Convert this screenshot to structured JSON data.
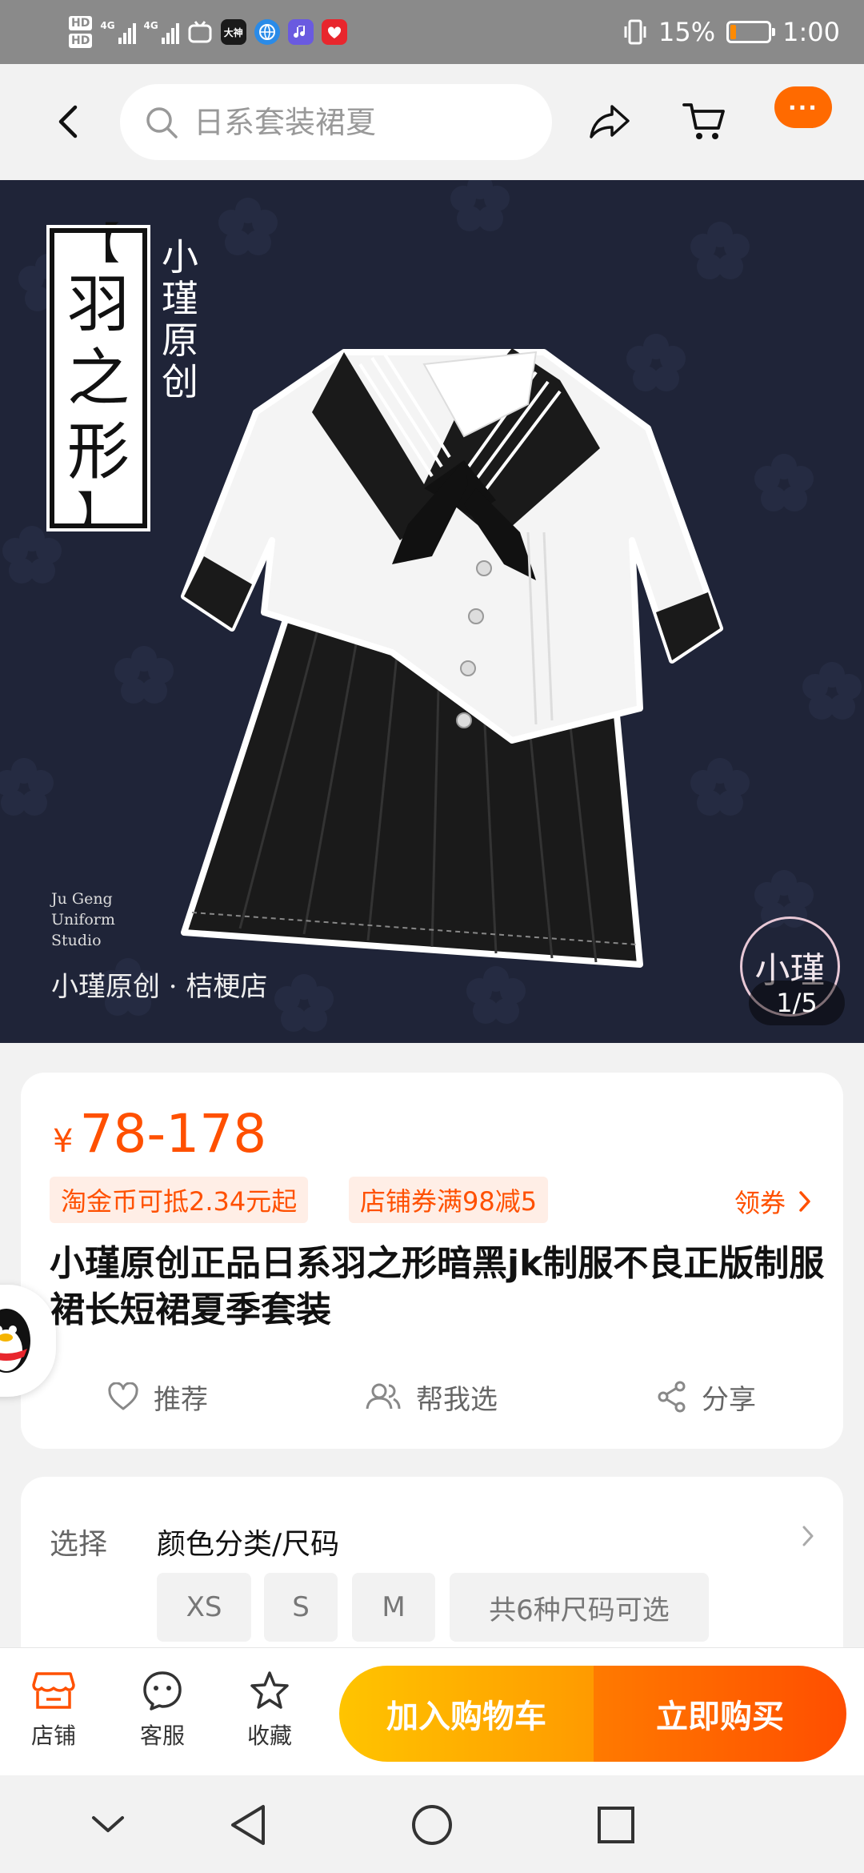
{
  "status_bar": {
    "hd1": "HD",
    "hd2": "HD",
    "net1": "4G",
    "net2": "4G",
    "app_dashen": "大神",
    "battery_text": "15%",
    "battery_level": 0.15,
    "time": "1:00"
  },
  "header": {
    "search_placeholder": "日系套装裙夏",
    "more_label": "···"
  },
  "product_image": {
    "series_name": [
      "羽",
      "之",
      "形"
    ],
    "bracket_top": "【",
    "bracket_bottom": "】",
    "brand_vertical": "小瑾原创",
    "studio_lines": [
      "Ju Geng",
      "Uniform",
      "Studio"
    ],
    "shop_line": "小瑾原创 · 桔梗店",
    "logo_text": "小瑾",
    "page_indicator": "1/5"
  },
  "price_card": {
    "currency": "¥",
    "price": "78-178",
    "tag_coins": "淘金币可抵2.34元起",
    "tag_coupon": "店铺券满98减5",
    "coupon_link": "领券",
    "title": "小瑾原创正品日系羽之形暗黑jk制服不良正版制服裙长短裙夏季套装",
    "actions": {
      "recommend": "推荐",
      "help_choose": "帮我选",
      "share": "分享"
    }
  },
  "select_card": {
    "label": "选择",
    "value": "颜色分类/尺码",
    "sizes": [
      "XS",
      "S",
      "M"
    ],
    "size_more": "共6种尺码可选"
  },
  "bottom_bar": {
    "shop": "店铺",
    "service": "客服",
    "favorite": "收藏",
    "add_to_cart": "加入购物车",
    "buy_now": "立即购买"
  },
  "colors": {
    "accent": "#ff5000",
    "cart_gradient_start": "#ffc400",
    "buy_gradient_end": "#ff4e00"
  }
}
